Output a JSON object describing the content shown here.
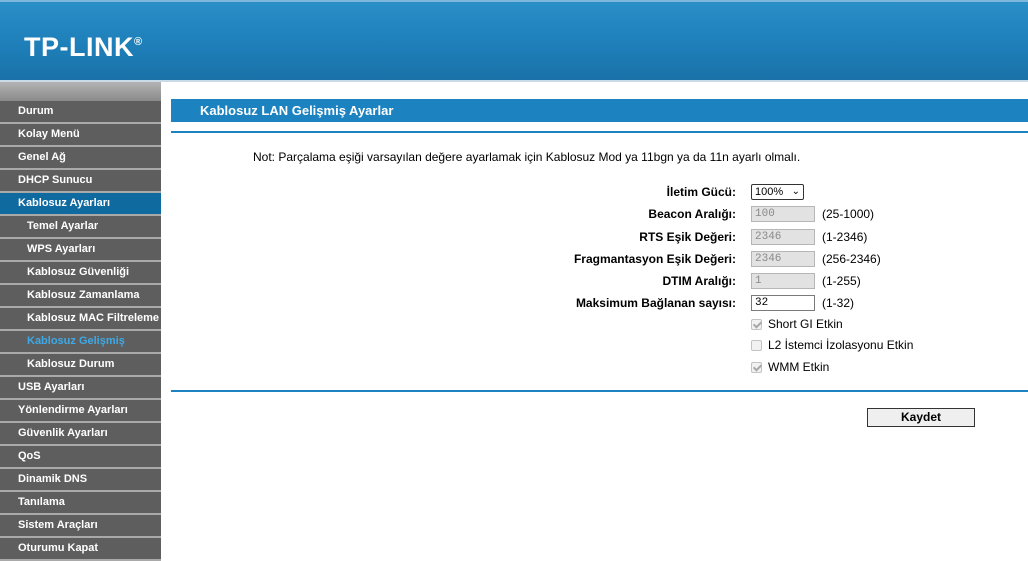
{
  "header": {
    "logo": "TP-LINK",
    "logo_mark": "®"
  },
  "sidebar": {
    "items": [
      {
        "label": "Durum"
      },
      {
        "label": "Kolay Menü"
      },
      {
        "label": "Genel Ağ"
      },
      {
        "label": "DHCP Sunucu"
      },
      {
        "label": "Kablosuz Ayarları"
      },
      {
        "label": "Temel Ayarlar"
      },
      {
        "label": "WPS Ayarları"
      },
      {
        "label": "Kablosuz Güvenliği"
      },
      {
        "label": "Kablosuz Zamanlama"
      },
      {
        "label": "Kablosuz MAC Filtreleme"
      },
      {
        "label": "Kablosuz Gelişmiş"
      },
      {
        "label": "Kablosuz Durum"
      },
      {
        "label": "USB Ayarları"
      },
      {
        "label": "Yönlendirme Ayarları"
      },
      {
        "label": "Güvenlik Ayarları"
      },
      {
        "label": "QoS"
      },
      {
        "label": "Dinamik DNS"
      },
      {
        "label": "Tanılama"
      },
      {
        "label": "Sistem Araçları"
      },
      {
        "label": "Oturumu Kapat"
      }
    ]
  },
  "main": {
    "title": "Kablosuz LAN Gelişmiş Ayarlar",
    "note": "Not: Parçalama eşiği varsayılan değere ayarlamak için Kablosuz Mod ya 11bgn ya da 11n ayarlı olmalı.",
    "transmit_power": {
      "label": "İletim Gücü:",
      "value": "100%"
    },
    "beacon": {
      "label": "Beacon Aralığı:",
      "value": "100",
      "range": "(25-1000)"
    },
    "rts": {
      "label": "RTS Eşik Değeri:",
      "value": "2346",
      "range": "(1-2346)"
    },
    "fragment": {
      "label": "Fragmantasyon Eşik Değeri:",
      "value": "2346",
      "range": "(256-2346)"
    },
    "dtim": {
      "label": "DTIM Aralığı:",
      "value": "1",
      "range": "(1-255)"
    },
    "max_clients": {
      "label": "Maksimum Bağlanan sayısı:",
      "value": "32",
      "range": "(1-32)"
    },
    "short_gi": {
      "label": "Short GI Etkin",
      "checked": true
    },
    "l2_isolation": {
      "label": "L2 İstemci İzolasyonu Etkin",
      "checked": false
    },
    "wmm": {
      "label": "WMM Etkin",
      "checked": true
    },
    "save_label": "Kaydet"
  }
}
